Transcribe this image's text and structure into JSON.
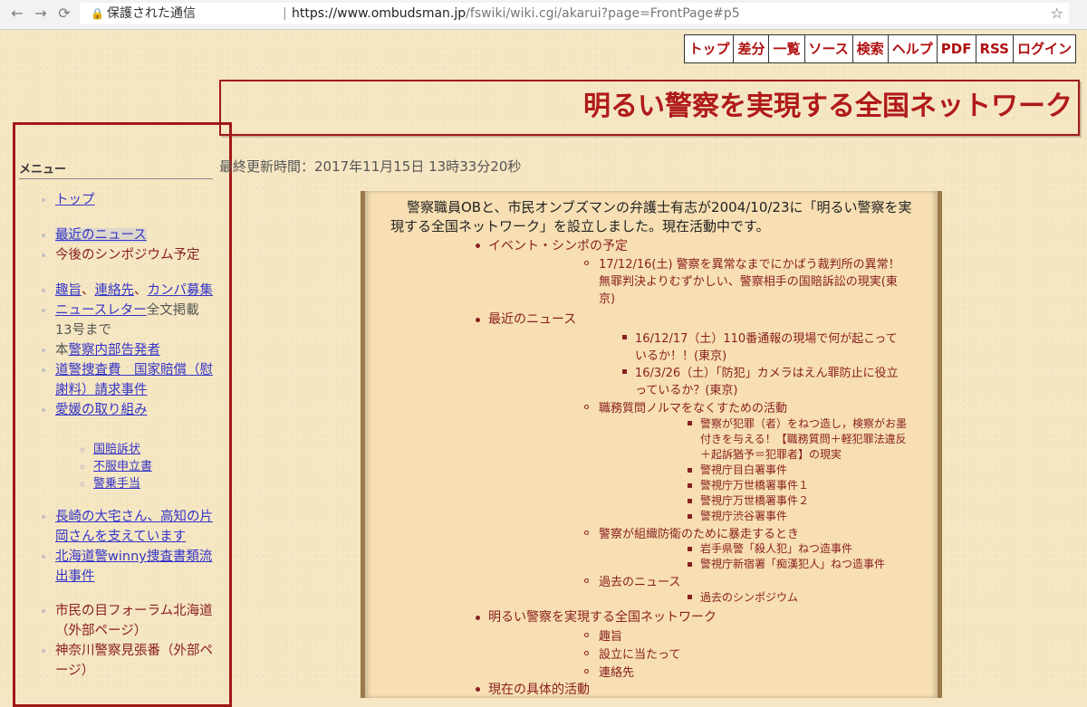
{
  "browser": {
    "back_icon": "←",
    "forward_icon": "→",
    "reload_icon": "⟳",
    "security": "保護された通信",
    "url_host": "https://www.ombudsman.jp",
    "url_path": "/fswiki/wiki.cgi/akarui?page=FrontPage#p5",
    "star_icon": "☆"
  },
  "topmenu": [
    "トップ",
    "差分",
    "一覧",
    "ソース",
    "検索",
    "ヘルプ",
    "PDF",
    "RSS",
    "ログイン"
  ],
  "title": "明るい警察を実現する全国ネットワーク",
  "updated": "最終更新時間：2017年11月15日 13時33分20秒",
  "sidebar": {
    "heading": "メニュー",
    "items": {
      "top": "トップ",
      "news": "最近のニュース",
      "symposium": "今後のシンポジウム予定",
      "shushi": "趣旨",
      "sep1": "、",
      "renraku": "連絡先",
      "sep2": "、",
      "kanpa": "カンパ募集",
      "newsletter": "ニュースレター",
      "newsletter_rest": "全文掲載　13号まで",
      "hon_pre": "本",
      "hon_link": "警察内部告発者",
      "doukei": "道警捜査費　国家賠償（慰謝料）請求事件",
      "ehime": "愛媛の取り組み",
      "ehime_sub": [
        "国賠訴状",
        "不服申立書",
        "警乗手当"
      ],
      "nagasaki": "長崎の大宅さん、高知の片岡さんを支えています",
      "winny": "北海道警winny捜査書類流出事件",
      "forum": "市民の目フォーラム北海道（外部ページ）",
      "kanagawa": "神奈川警察見張番（外部ページ）"
    }
  },
  "content": {
    "intro": "警察職員OBと、市民オンブズマンの弁護士有志が2004/10/23に「明るい警察を実現する全国ネットワーク」を設立しました。現在活動中です。",
    "event": "イベント・シンポの予定",
    "event1": "17/12/16(土) 警察を異常なまでにかばう裁判所の異常！",
    "event1b": "無罪判決よりむずかしい、警察相手の国賠訴訟の現実(東",
    "event1c": "京)",
    "recent": "最近のニュース",
    "n1a": "16/12/17（土）110番通報の現場で何が起こって",
    "n1b": "いるか！！(東京)",
    "n2a": "16/3/26（土）「防犯」カメラはえん罪防止に役立",
    "n2b": "っているか？(東京)",
    "norma": "職務質問ノルマをなくすための活動",
    "nm1a": "警察が犯罪（者）をねつ造し，検察がお墨",
    "nm1b": "付きを与える！【職務質問＋軽犯罪法違反",
    "nm1c": "＋起訴猶予＝犯罪者】の現実",
    "nm2": "警視庁目白署事件",
    "nm3": "警視庁万世橋署事件１",
    "nm4": "警視庁万世橋署事件２",
    "nm5": "警視庁渋谷署事件",
    "soshiki": "警察が組織防衛のために暴走するとき",
    "so1": "岩手県警「殺人犯」ねつ造事件",
    "so2": "警視庁新宿署「痴漢犯人」ねつ造事件",
    "past": "過去のニュース",
    "past1": "過去のシンポジウム",
    "network": "明るい警察を実現する全国ネットワーク",
    "nw1": "趣旨",
    "nw2": "設立に当たって",
    "nw3": "連絡先",
    "current": "現在の具体的活動"
  }
}
